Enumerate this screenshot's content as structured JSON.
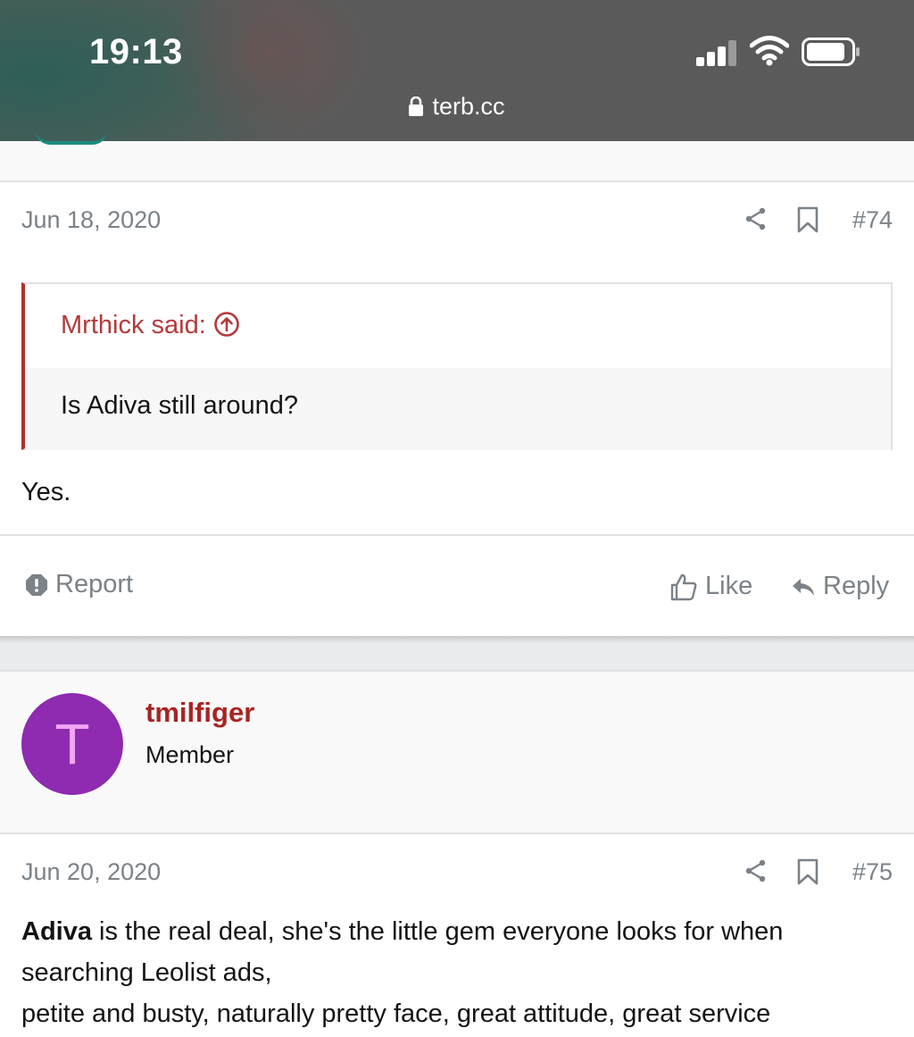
{
  "status_bar": {
    "time": "19:13",
    "url": "terb.cc",
    "icons": [
      "lock-icon",
      "cellular-signal-icon",
      "wifi-icon",
      "battery-icon"
    ]
  },
  "colors": {
    "accent": "#b32d2d",
    "username": "#a82424",
    "muted": "#7b8288",
    "avatar_bg": "#8e2bb0"
  },
  "post_74": {
    "date": "Jun 18, 2020",
    "number": "#74",
    "quote": {
      "author_line": "Mrthick said:",
      "text": "Is Adiva still around?"
    },
    "body": "Yes.",
    "actions": {
      "report": "Report",
      "like": "Like",
      "reply": "Reply"
    }
  },
  "post_75": {
    "author": {
      "avatar_letter": "T",
      "username": "tmilfiger",
      "title": "Member"
    },
    "date": "Jun 20, 2020",
    "number": "#75",
    "body": {
      "bold_lead": "Adiva",
      "line1_rest": " is the real deal, she's the little gem everyone looks for when",
      "line2": "searching Leolist ads,",
      "line3": "petite and busty, naturally pretty face, great attitude, great service"
    }
  }
}
